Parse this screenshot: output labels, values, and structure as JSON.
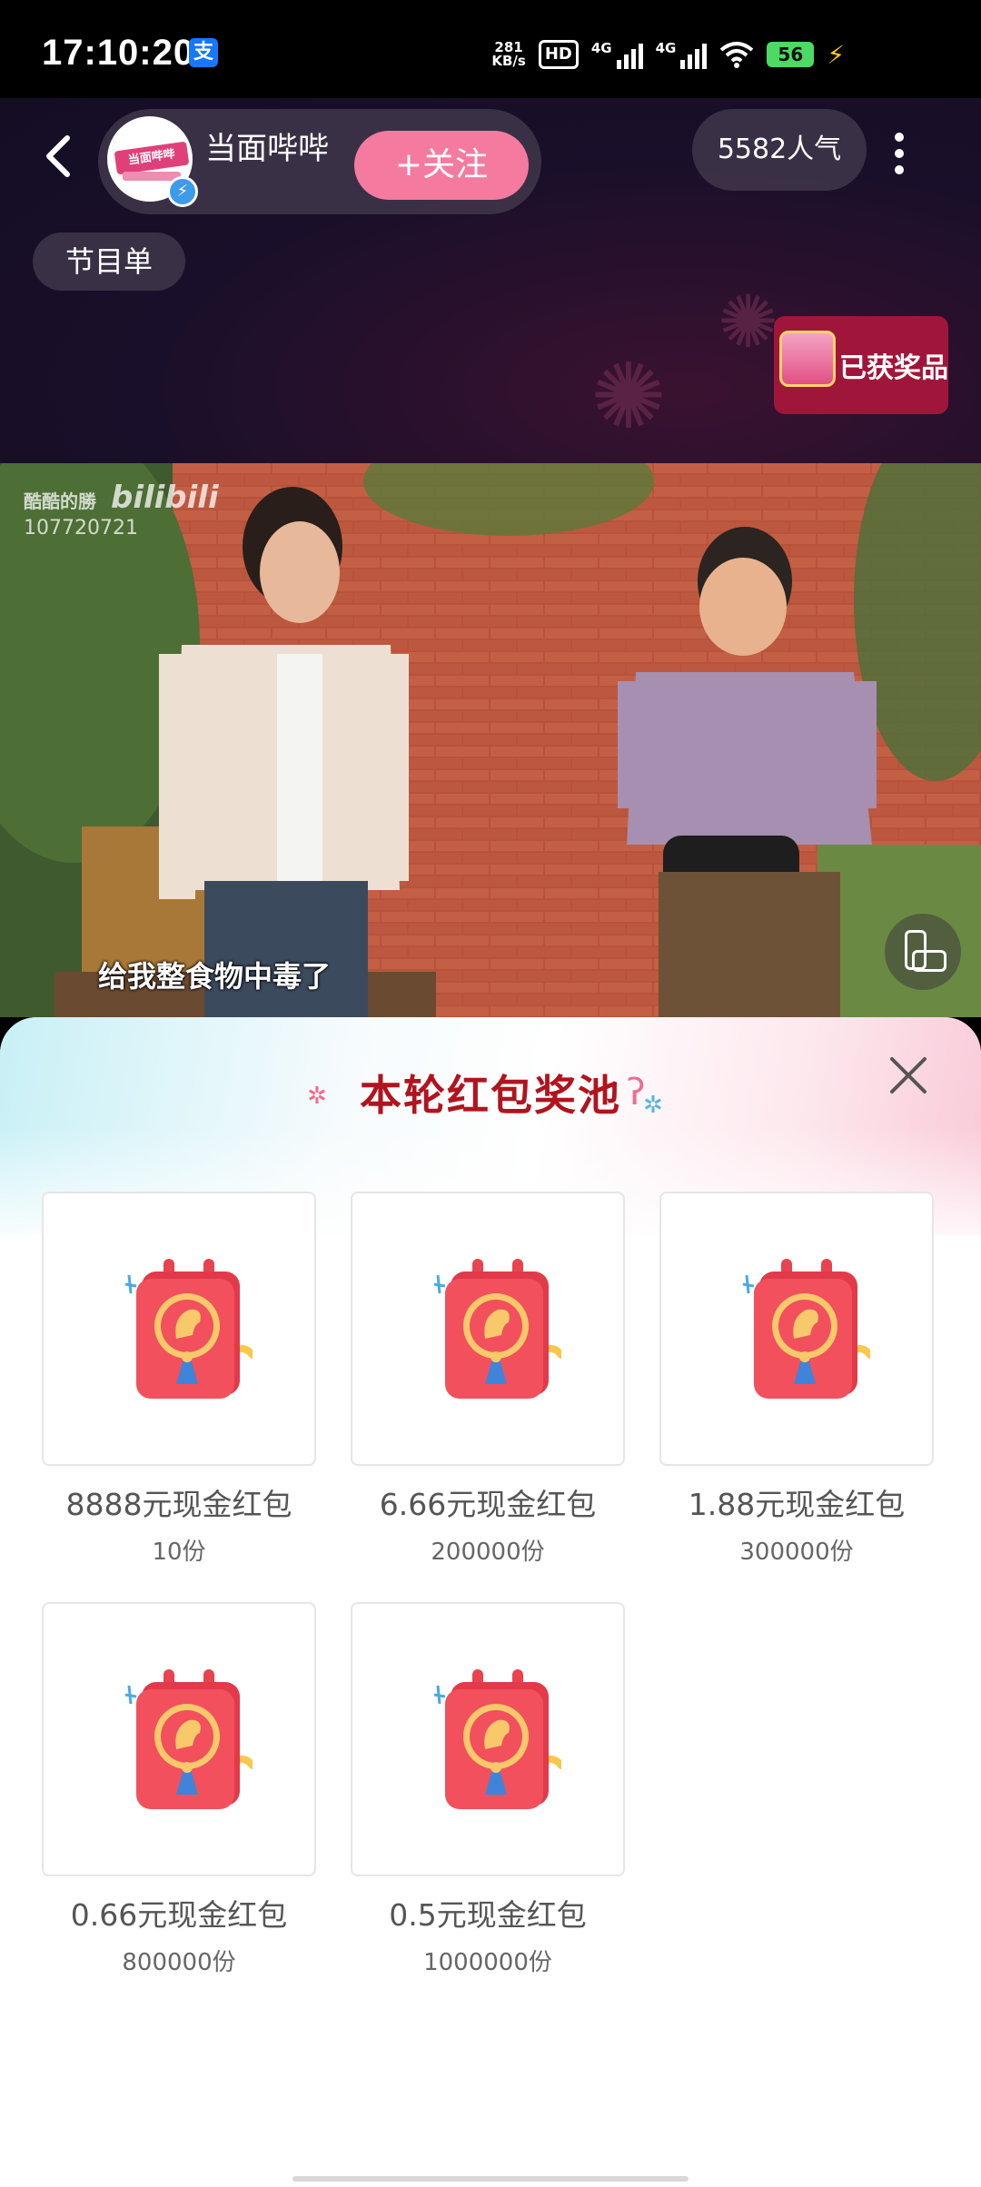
{
  "status_bar": {
    "time": "17:10:20",
    "alipay_icon": "支",
    "net_speed_value": "281",
    "net_speed_unit": "KB/s",
    "hd_label": "HD",
    "sim1_label": "4G",
    "sim2_label": "4G",
    "battery": "56"
  },
  "header": {
    "host_name": "当面哔哔",
    "avatar_text": "当面哔哔",
    "follow_label": "+关注",
    "popularity": "5582人气",
    "program_list": "节目单",
    "prize_label": "已获奖品"
  },
  "video": {
    "watermark_name": "酷酷的勝",
    "watermark_logo": "bilibili",
    "watermark_id": "107720721",
    "subtitle": "给我整食物中毒了"
  },
  "pool": {
    "title": "本轮红包奖池",
    "items": [
      {
        "label": "8888元现金红包",
        "count": "10份"
      },
      {
        "label": "6.66元现金红包",
        "count": "200000份"
      },
      {
        "label": "1.88元现金红包",
        "count": "300000份"
      },
      {
        "label": "0.66元现金红包",
        "count": "800000份"
      },
      {
        "label": "0.5元现金红包",
        "count": "1000000份"
      }
    ]
  },
  "colors": {
    "follow": "#f57aa0",
    "prize_bg": "#a0163a",
    "title": "#b1141e"
  }
}
